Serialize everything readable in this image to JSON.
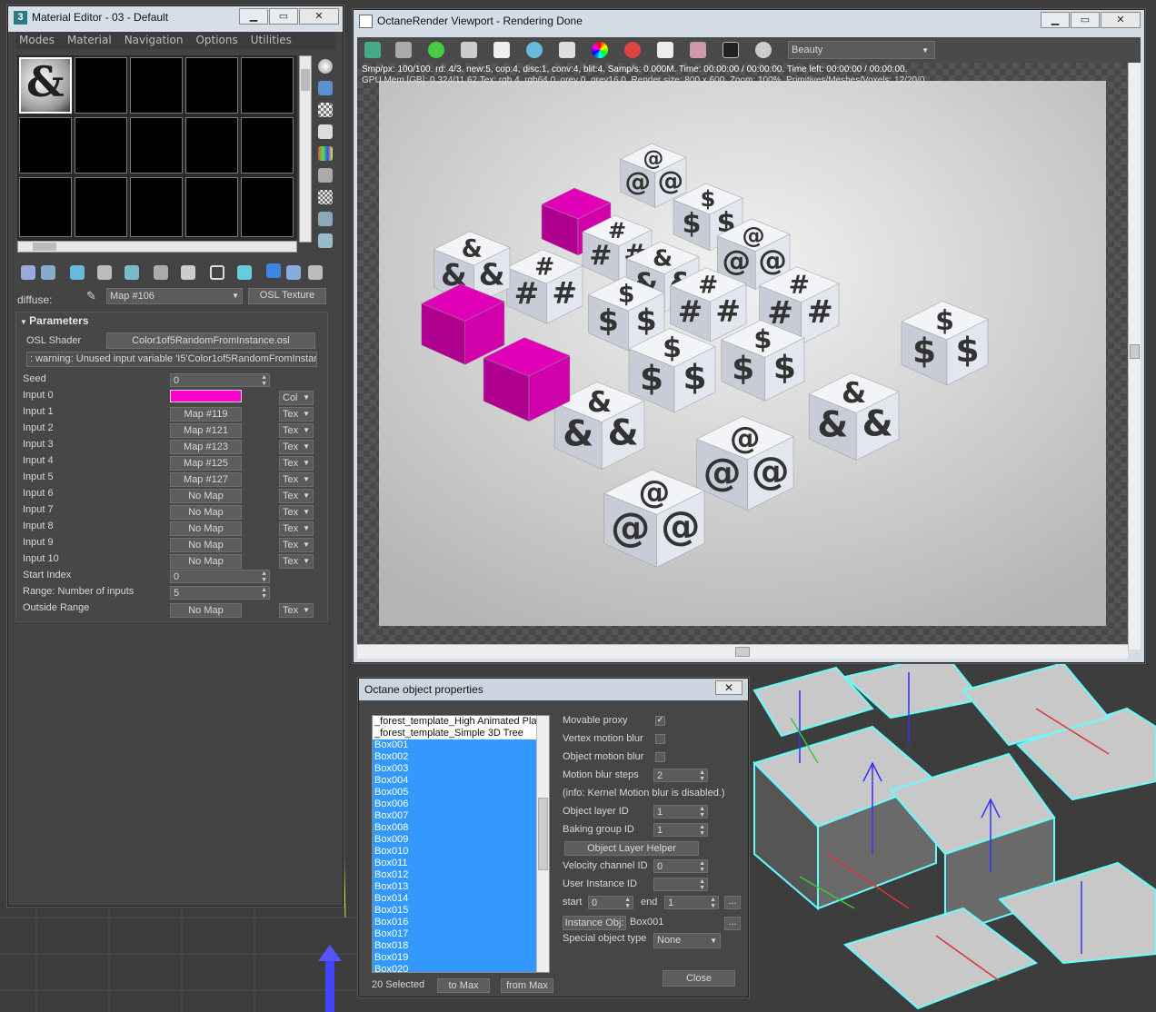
{
  "material_editor": {
    "title": "Material Editor - 03 - Default",
    "app_icon": "3",
    "menu": [
      "Modes",
      "Material",
      "Navigation",
      "Options",
      "Utilities"
    ],
    "slot_symbol": "&",
    "map_label": "diffuse:",
    "map_value": "Map #106",
    "map_type_button": "OSL Texture",
    "rollout_title": "Parameters",
    "osl_label": "OSL Shader",
    "osl_file": "Color1of5RandomFromInstance.osl",
    "warning": ": warning: Unused input variable 'I5'Color1of5RandomFromInstar",
    "seed_label": "Seed",
    "seed_value": "0",
    "input0_label": "Input 0",
    "input0_color": "#ff00cc",
    "input0_type": "Col",
    "inputs": [
      {
        "label": "Input 1",
        "value": "Map #119",
        "type": "Tex"
      },
      {
        "label": "Input 2",
        "value": "Map #121",
        "type": "Tex"
      },
      {
        "label": "Input 3",
        "value": "Map #123",
        "type": "Tex"
      },
      {
        "label": "Input 4",
        "value": "Map #125",
        "type": "Tex"
      },
      {
        "label": "Input 5",
        "value": "Map #127",
        "type": "Tex"
      },
      {
        "label": "Input 6",
        "value": "No Map",
        "type": "Tex"
      },
      {
        "label": "Input 7",
        "value": "No Map",
        "type": "Tex"
      },
      {
        "label": "Input 8",
        "value": "No Map",
        "type": "Tex"
      },
      {
        "label": "Input 9",
        "value": "No Map",
        "type": "Tex"
      },
      {
        "label": "Input 10",
        "value": "No Map",
        "type": "Tex"
      }
    ],
    "start_index_label": "Start Index",
    "start_index_value": "0",
    "range_label": "Range: Number of inputs",
    "range_value": "5",
    "outside_label": "Outside Range",
    "outside_value": "No Map",
    "outside_type": "Tex"
  },
  "viewport": {
    "title": "OctaneRender Viewport - Rendering Done",
    "pass_select": "Beauty",
    "stats_line1": "Smp/px: 100/100.   rd: 4/3.   new:5, cop:4, disc:1, conv:4, blit:4.   Samp/s: 0.000M.   Time: 00:00:00 / 00:00:00.   Time left: 00:00:00 / 00:00:00.",
    "stats_line2": "GPU Mem [GB]: 0.324/11.62   Tex: rgb 4, rgb64 0, grey 0, grey16 0.   Render size: 800 x 600.   Zoom: 100%.   Primitives/Meshes/Voxels: 12/20/0",
    "accent_magenta": "#e000b8",
    "cubes": [
      "@",
      "$",
      "&",
      "#",
      "&",
      "@",
      "#",
      "$",
      "#",
      "&",
      "#",
      "$",
      "$",
      "&",
      "&",
      "$",
      "&",
      "@",
      "@",
      "&"
    ]
  },
  "object_props": {
    "title": "Octane object properties",
    "list": [
      "_forest_template_High Animated Plant",
      "_forest_template_Simple 3D Tree",
      "Box001",
      "Box002",
      "Box003",
      "Box004",
      "Box005",
      "Box006",
      "Box007",
      "Box008",
      "Box009",
      "Box010",
      "Box011",
      "Box012",
      "Box013",
      "Box014",
      "Box015",
      "Box016",
      "Box017",
      "Box018",
      "Box019",
      "Box020"
    ],
    "selected_count": "20 Selected",
    "to_max": "to Max",
    "from_max": "from Max",
    "movable_proxy": "Movable proxy",
    "vertex_motion_blur": "Vertex motion blur",
    "object_motion_blur": "Object motion blur",
    "motion_blur_steps_label": "Motion blur steps",
    "motion_blur_steps": "2",
    "info": "(info: Kernel Motion blur is disabled.)",
    "object_layer_id_label": "Object layer ID",
    "object_layer_id": "1",
    "baking_group_id_label": "Baking group ID",
    "baking_group_id": "1",
    "layer_helper": "Object Layer Helper",
    "velocity_label": "Velocity channel ID",
    "velocity_value": "0",
    "user_instance_label": "User Instance ID",
    "start_label": "start",
    "start_value": "0",
    "end_label": "end",
    "end_value": "1",
    "ellipsis": "...",
    "instance_obj_label": "Instance Obj:",
    "instance_obj_value": "Box001",
    "special_type_label": "Special object type",
    "special_type_value": "None",
    "close": "Close"
  }
}
